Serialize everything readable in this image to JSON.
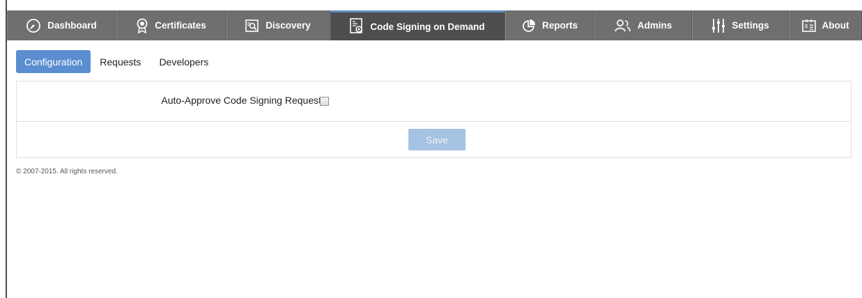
{
  "nav": {
    "items": [
      {
        "label": "Dashboard",
        "icon": "gauge-icon",
        "active": false
      },
      {
        "label": "Certificates",
        "icon": "certificate-badge-icon",
        "active": false
      },
      {
        "label": "Discovery",
        "icon": "discovery-search-icon",
        "active": false
      },
      {
        "label": "Code Signing on Demand",
        "icon": "code-signing-icon",
        "active": true
      },
      {
        "label": "Reports",
        "icon": "pie-chart-icon",
        "active": false
      },
      {
        "label": "Admins",
        "icon": "admins-icon",
        "active": false
      },
      {
        "label": "Settings",
        "icon": "sliders-icon",
        "active": false
      },
      {
        "label": "About",
        "icon": "about-icon",
        "active": false
      }
    ]
  },
  "subtabs": {
    "configuration": "Configuration",
    "requests": "Requests",
    "developers": "Developers"
  },
  "config": {
    "auto_approve_label": "Auto-Approve Code Signing Requests",
    "auto_approve_checked": false,
    "save_label": "Save"
  },
  "footer": {
    "copyright": "© 2007-2015. All rights reserved."
  },
  "colors": {
    "nav_bg": "#6f6f6f",
    "nav_active_bg": "#4e4e4e",
    "accent": "#5b8ed0",
    "save_disabled": "#a4c2e2"
  }
}
